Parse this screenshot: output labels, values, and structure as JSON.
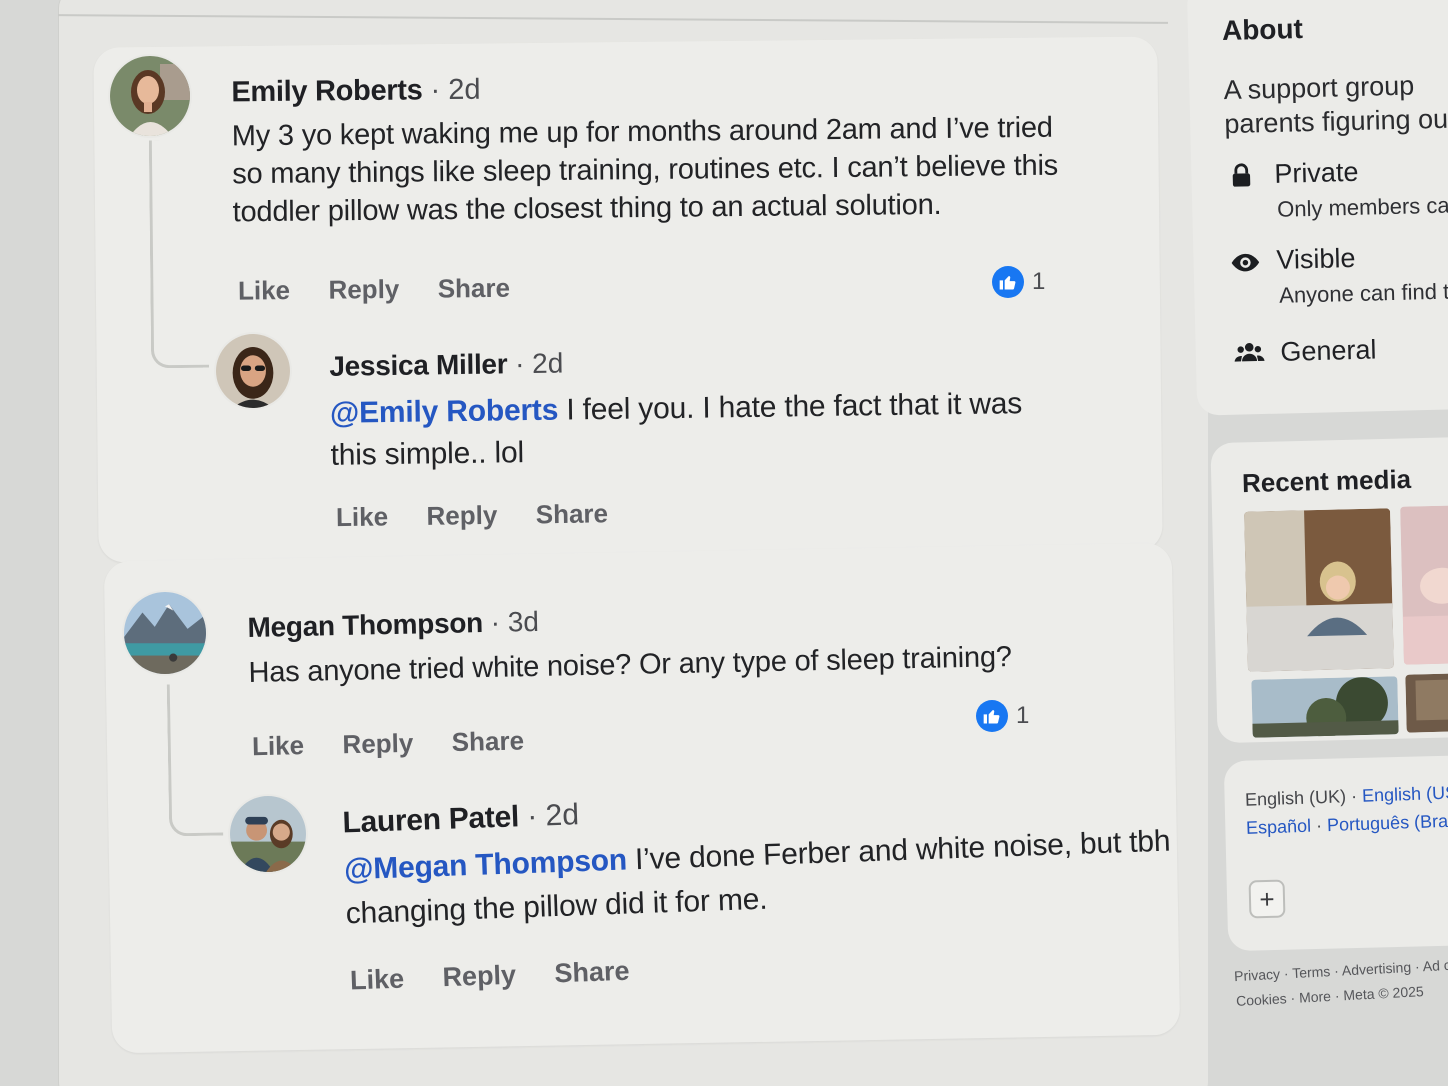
{
  "comments": [
    {
      "author": "Emily Roberts",
      "separator": "·",
      "time": "2d",
      "lines": [
        "My 3 yo kept waking me up for months around 2am and I’ve tried",
        "so many things like sleep training, routines etc. I can’t believe this",
        "toddler pillow was the closest thing to an actual solution."
      ],
      "actions": {
        "like": "Like",
        "reply": "Reply",
        "share": "Share"
      },
      "reaction_count": "1",
      "reply": {
        "author": "Jessica Miller",
        "separator": "·",
        "time": "2d",
        "mention": "@Emily Roberts",
        "line1_rest": " I feel you. I hate the fact that it was",
        "line2": "this simple.. lol",
        "actions": {
          "like": "Like",
          "reply": "Reply",
          "share": "Share"
        }
      }
    },
    {
      "author": "Megan Thompson",
      "separator": "·",
      "time": "3d",
      "lines": [
        "Has anyone tried white noise? Or any type of sleep training?"
      ],
      "actions": {
        "like": "Like",
        "reply": "Reply",
        "share": "Share"
      },
      "reaction_count": "1",
      "reply": {
        "author": "Lauren Patel",
        "separator": "·",
        "time": "2d",
        "mention": "@Megan Thompson",
        "line1_rest": " I’ve done Ferber and white noise, but tbh",
        "line2": "changing the pillow did it for me.",
        "actions": {
          "like": "Like",
          "reply": "Reply",
          "share": "Share"
        }
      }
    }
  ],
  "sidebar": {
    "about": {
      "title": "About",
      "desc_line1": "A support group",
      "desc_line2": "parents figuring out",
      "items": [
        {
          "icon": "lock-icon",
          "label": "Private",
          "sub": "Only members can"
        },
        {
          "icon": "eye-icon",
          "label": "Visible",
          "sub": "Anyone can find th"
        },
        {
          "icon": "group-icon",
          "label": "General",
          "sub": ""
        }
      ]
    },
    "recent_media": {
      "title": "Recent media"
    },
    "languages": {
      "current": "English (UK)",
      "links": [
        "English (US)",
        "Español",
        "Português (Brasil)"
      ],
      "dot": "·"
    },
    "add_button": "+",
    "footer": {
      "row1": [
        "Privacy",
        "Terms",
        "Advertising",
        "Ad choi"
      ],
      "row2": [
        "Cookies",
        "More"
      ],
      "copyright": "Meta © 2025"
    }
  },
  "colors": {
    "accent": "#1877f2",
    "mention": "#2557c2",
    "page_bg": "#d7d8d6",
    "card_bg": "#ededea"
  }
}
